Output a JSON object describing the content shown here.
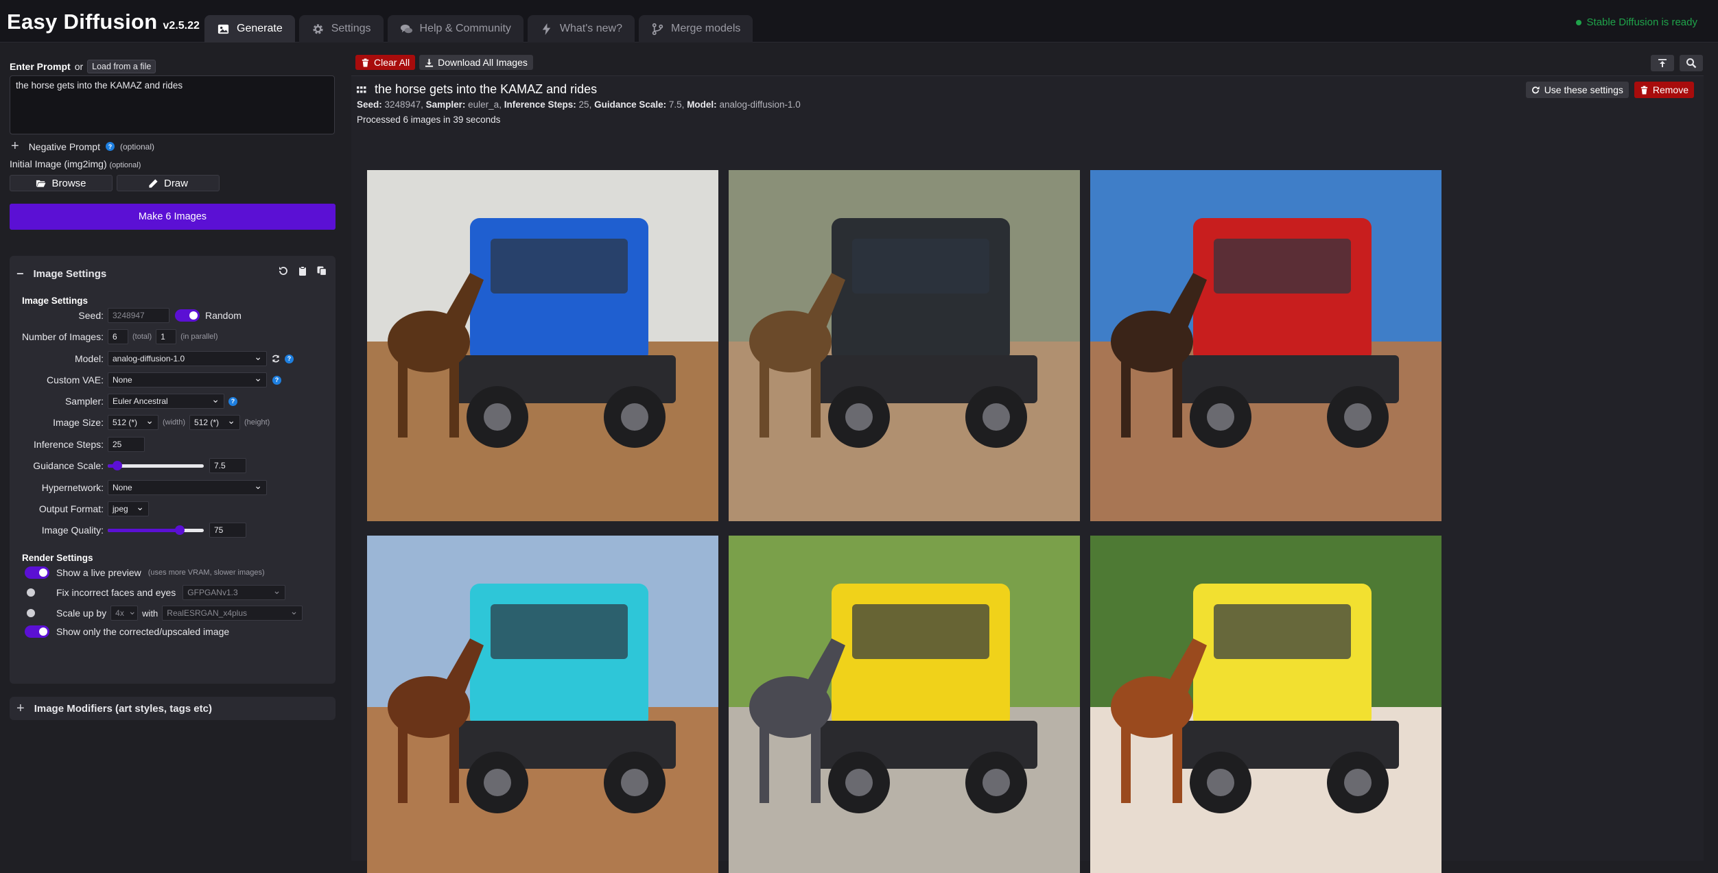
{
  "app": {
    "name": "Easy Diffusion",
    "version": "v2.5.22",
    "status": "Stable Diffusion is ready"
  },
  "nav": {
    "tabs": [
      {
        "label": "Generate",
        "icon": "image-icon",
        "active": true
      },
      {
        "label": "Settings",
        "icon": "gear-icon"
      },
      {
        "label": "Help & Community",
        "icon": "comments-icon"
      },
      {
        "label": "What's new?",
        "icon": "bolt-icon"
      },
      {
        "label": "Merge models",
        "icon": "code-branch-icon"
      }
    ]
  },
  "prompt": {
    "label": "Enter Prompt",
    "or": "or",
    "load_button": "Load from a file",
    "value": "the horse gets into the KAMAZ and rides",
    "negative_label": "Negative Prompt",
    "optional": "(optional)",
    "initial_image_label": "Initial Image (img2img)",
    "browse_label": "Browse",
    "draw_label": "Draw",
    "make_button": "Make 6 Images"
  },
  "image_settings": {
    "title": "Image Settings",
    "subheading": "Image Settings",
    "seed": {
      "label": "Seed:",
      "value": "3248947",
      "random_label": "Random",
      "random_on": true
    },
    "num_images": {
      "label": "Number of Images:",
      "total": "6",
      "total_hint": "(total)",
      "parallel": "1",
      "parallel_hint": "(in parallel)"
    },
    "model": {
      "label": "Model:",
      "value": "analog-diffusion-1.0"
    },
    "custom_vae": {
      "label": "Custom VAE:",
      "value": "None"
    },
    "sampler": {
      "label": "Sampler:",
      "value": "Euler Ancestral"
    },
    "image_size": {
      "label": "Image Size:",
      "width": "512 (*)",
      "width_hint": "(width)",
      "height": "512 (*)",
      "height_hint": "(height)"
    },
    "inference_steps": {
      "label": "Inference Steps:",
      "value": "25"
    },
    "guidance_scale": {
      "label": "Guidance Scale:",
      "value": "7.5",
      "slider_fraction": 0.1
    },
    "hypernetwork": {
      "label": "Hypernetwork:",
      "value": "None"
    },
    "output_format": {
      "label": "Output Format:",
      "value": "jpeg"
    },
    "image_quality": {
      "label": "Image Quality:",
      "value": "75",
      "slider_fraction": 0.75
    }
  },
  "render_settings": {
    "title": "Render Settings",
    "live_preview": {
      "label": "Show a live preview",
      "hint": "(uses more VRAM, slower images)",
      "on": true
    },
    "fix_faces": {
      "label": "Fix incorrect faces and eyes",
      "model": "GFPGANv1.3",
      "on": false
    },
    "upscale": {
      "label": "Scale up by",
      "factor": "4x",
      "with": "with",
      "model": "RealESRGAN_x4plus",
      "on": false
    },
    "show_corrected": {
      "label": "Show only the corrected/upscaled image",
      "on": true
    }
  },
  "modifiers": {
    "title": "Image Modifiers (art styles, tags etc)"
  },
  "toolbar": {
    "clear_all": "Clear All",
    "download_all": "Download All Images"
  },
  "task": {
    "title": "the horse gets into the KAMAZ and rides",
    "meta": {
      "seed_label": "Seed:",
      "seed": "3248947",
      "sampler_label": "Sampler:",
      "sampler": "euler_a",
      "steps_label": "Inference Steps:",
      "steps": "25",
      "guidance_label": "Guidance Scale:",
      "guidance": "7.5",
      "model_label": "Model:",
      "model": "analog-diffusion-1.0"
    },
    "processed": "Processed 6 images in 39 seconds",
    "use_settings": "Use these settings",
    "remove": "Remove"
  },
  "images": [
    {
      "sky": "#dcdcd8",
      "ground": "#a8784c",
      "truck": "#1f5fd0",
      "horse": "#5a3418"
    },
    {
      "sky": "#8a9078",
      "ground": "#b09070",
      "truck": "#2a2e33",
      "horse": "#6b4a2a"
    },
    {
      "sky": "#3f7ec8",
      "ground": "#a87654",
      "truck": "#c81e1e",
      "horse": "#3a2418"
    },
    {
      "sky": "#9bb6d6",
      "ground": "#b07a4e",
      "truck": "#2ec6d8",
      "horse": "#6a3418"
    },
    {
      "sky": "#7aa04a",
      "ground": "#b8b2a8",
      "truck": "#f0d21a",
      "horse": "#4a4a52"
    },
    {
      "sky": "#4e7a34",
      "ground": "#e8dcd0",
      "truck": "#f2e030",
      "horse": "#9a4a1e"
    }
  ],
  "colors": {
    "accent": "#5b10d4",
    "danger": "#a80c0c",
    "info": "#1e7fe0",
    "ready": "#1fa34a"
  }
}
